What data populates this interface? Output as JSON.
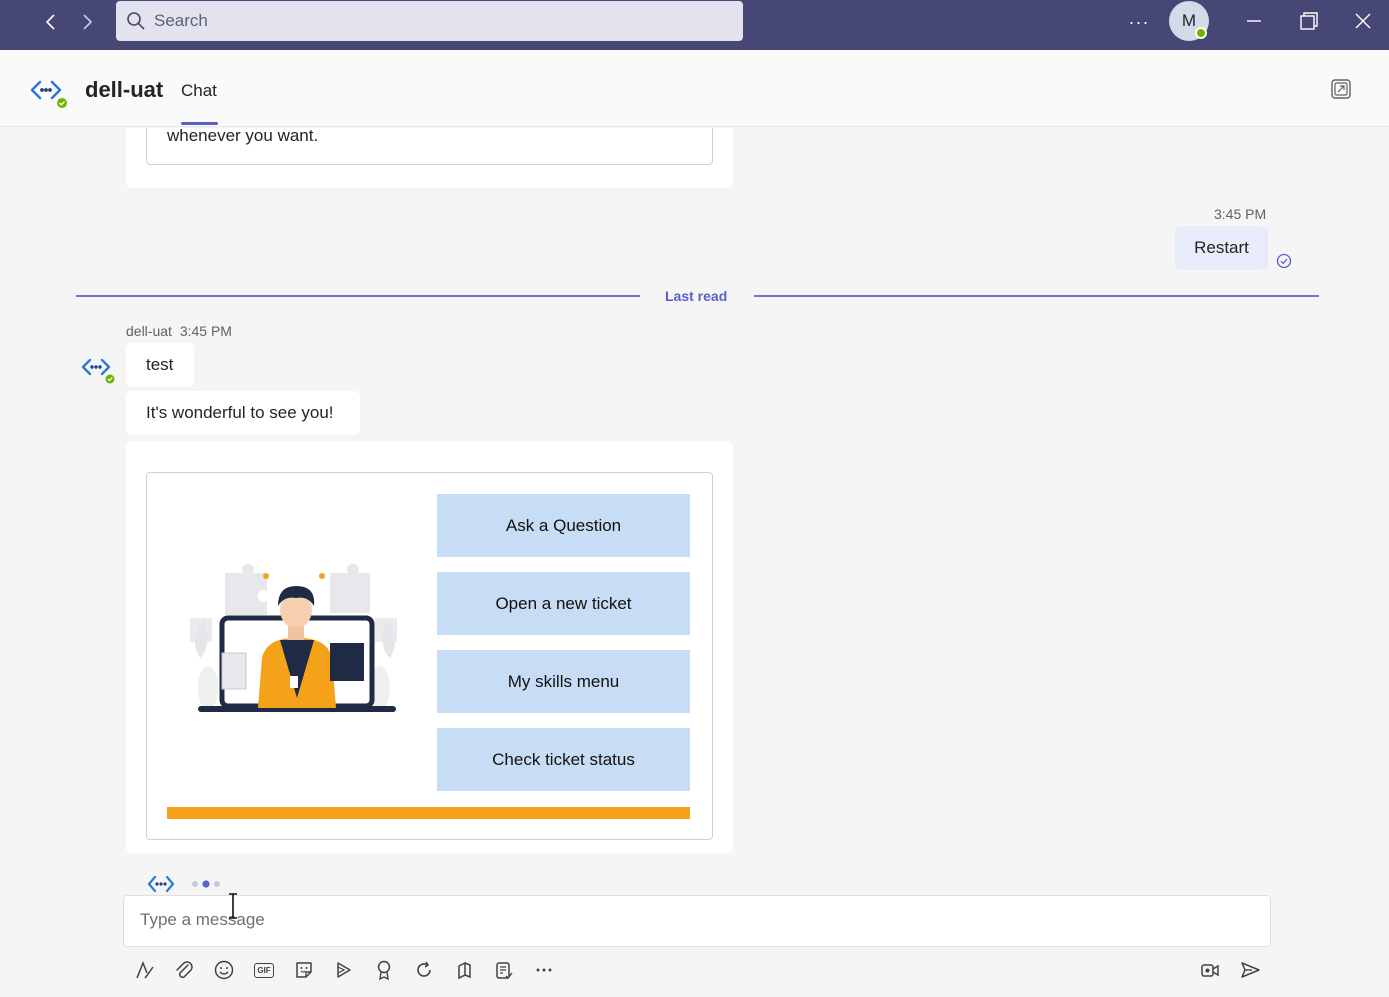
{
  "titlebar": {
    "search_placeholder": "Search",
    "more_label": "···",
    "avatar_initial": "M",
    "colors": {
      "bar": "#464775",
      "search": "#e2e3ee",
      "presence": "#6bb700"
    },
    "icons": [
      "back-icon",
      "forward-icon",
      "search-icon",
      "more-icon",
      "minimize-icon",
      "restore-icon",
      "close-icon"
    ]
  },
  "header": {
    "bot_name": "dell-uat",
    "tab_label": "Chat",
    "icons": [
      "bot-logo-icon",
      "popout-icon"
    ]
  },
  "chat": {
    "prev_message_text": "whenever you want.",
    "user_message": {
      "time": "3:45 PM",
      "text": "Restart"
    },
    "last_read_label": "Last read",
    "bot_reply": {
      "sender": "dell-uat",
      "time": "3:45 PM",
      "messages": [
        "test",
        "It's wonderful to see you!"
      ],
      "card": {
        "choices": [
          "Ask a Question",
          "Open a new ticket",
          "My skills menu",
          "Check ticket status"
        ],
        "accent_color": "#f5a21b",
        "button_color": "#c7dcf5"
      }
    }
  },
  "compose": {
    "placeholder": "Type a message",
    "tools": [
      "format-icon",
      "attach-icon",
      "emoji-icon",
      "gif-icon",
      "sticker-icon",
      "meet-now-icon",
      "praise-icon",
      "loop-icon",
      "apps-icon",
      "approvals-icon",
      "more-options-icon",
      "video-clip-icon",
      "send-icon"
    ],
    "gif_label": "GIF"
  }
}
